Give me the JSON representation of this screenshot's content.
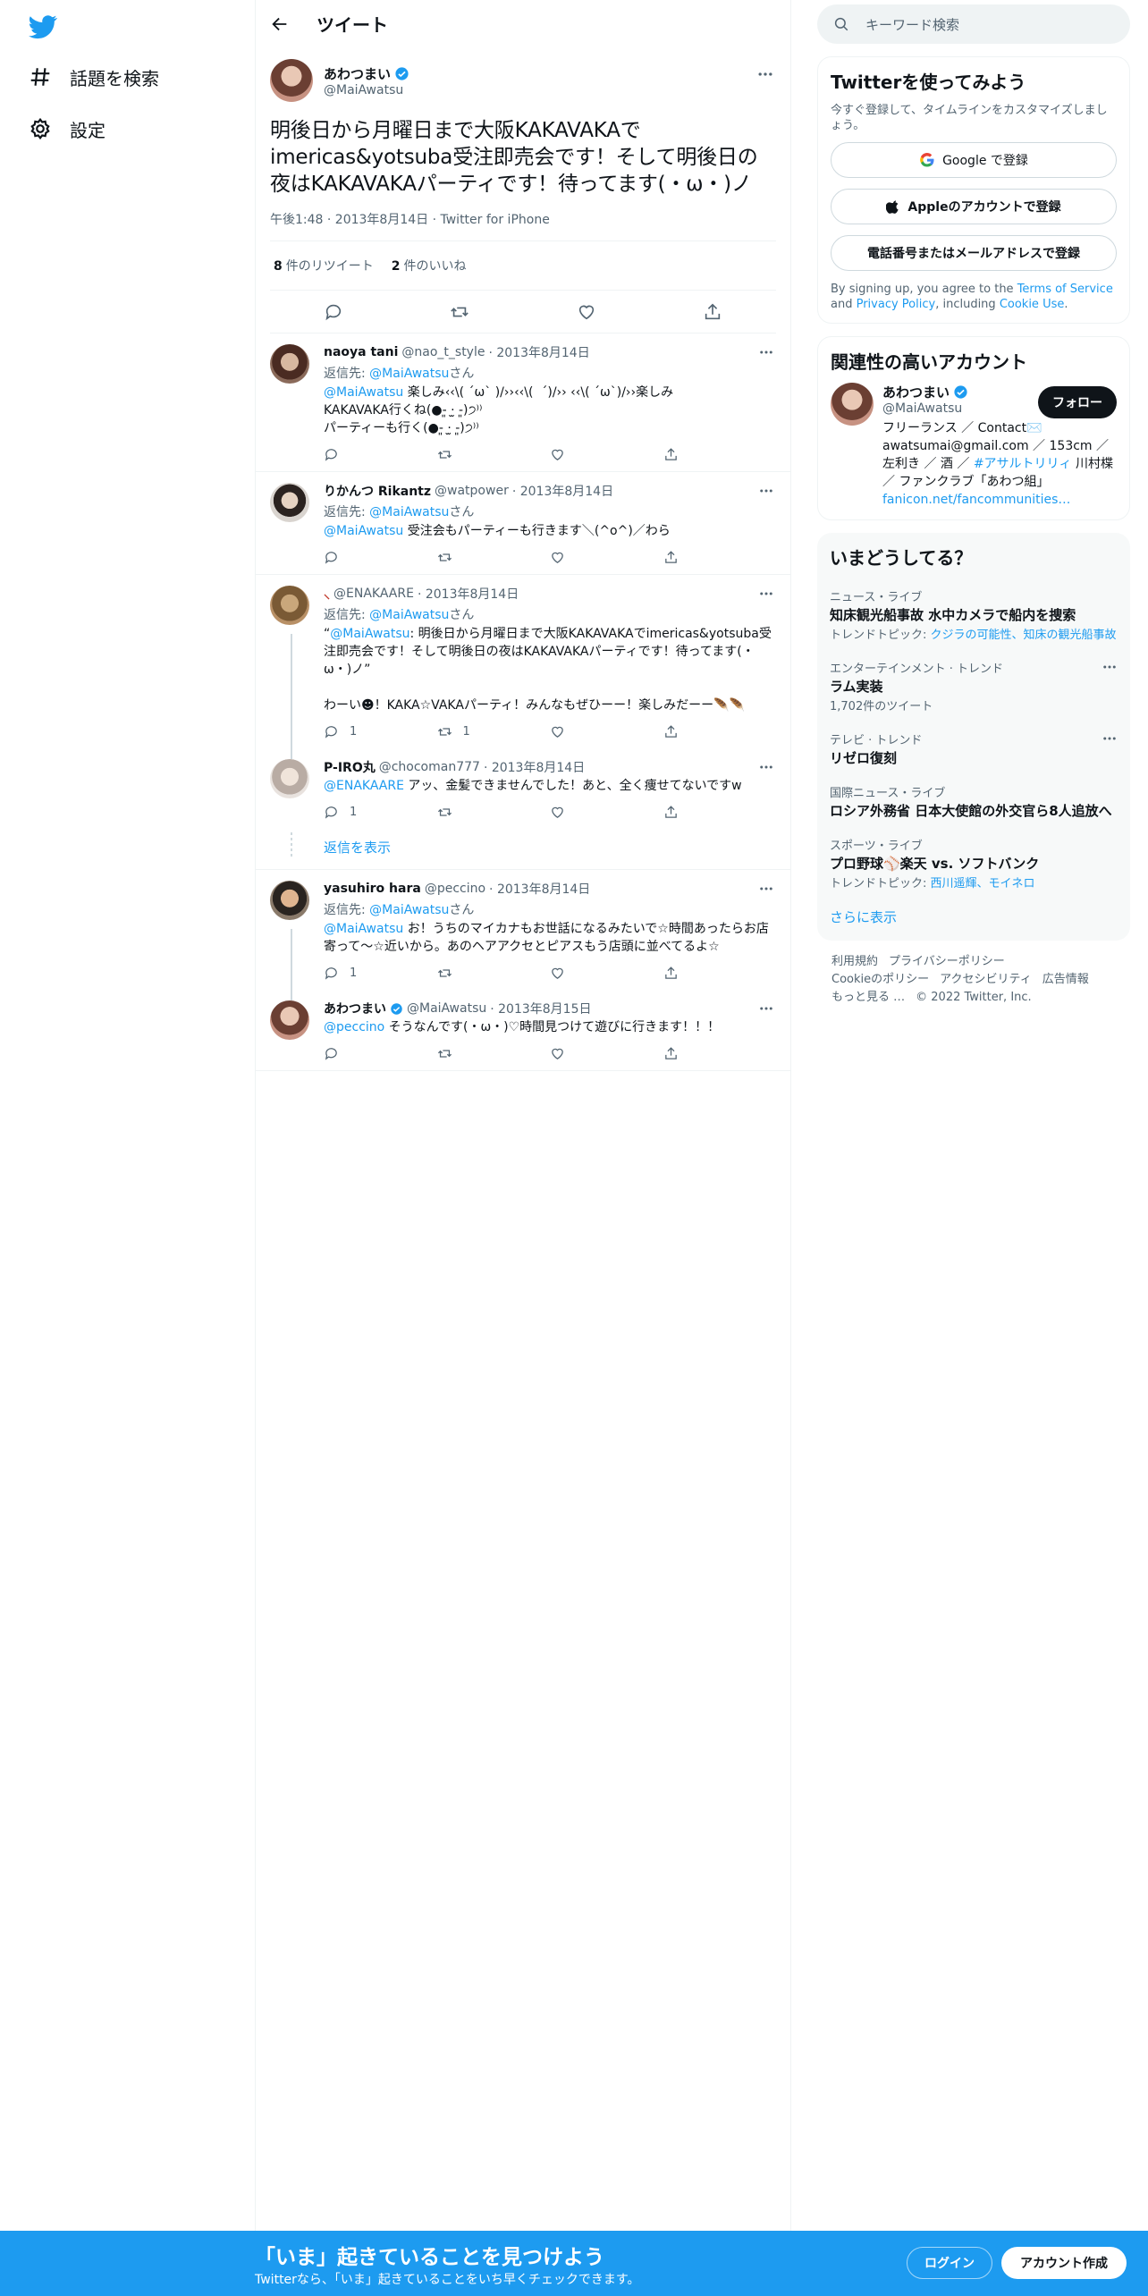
{
  "nav": {
    "explore": "話題を検索",
    "settings": "設定"
  },
  "header": {
    "title": "ツイート"
  },
  "main_tweet": {
    "name": "あわつまい",
    "handle": "@MaiAwatsu",
    "text": "明後日から月曜日まで大阪KAKAVAKAでimericas&yotsuba受注即売会です！そして明後日の夜はKAKAVAKAパーティです！待ってます(・ω・)ノ",
    "meta": "午後1:48 · 2013年8月14日 · Twitter for iPhone",
    "retweets": "8",
    "retweets_label": "件のリツイート",
    "likes": "2",
    "likes_label": "件のいいね"
  },
  "reply_prefix": "返信先: ",
  "reply_suffix": "さん",
  "replies": [
    {
      "name": "naoya tani",
      "handle": "@nao_t_style",
      "date": "· 2013年8月14日",
      "reply_to": "@MaiAwatsu",
      "mention": "@MaiAwatsu",
      "text": " 楽しみ‹‹\\( ´ω` )/››‹‹\\(  ´)/›› ‹‹\\( ´ω`)/››楽しみ\nKAKAVAKA行くね(●-͈ ·̫ -͈)੭⁾⁾\nパーティーも行く(●-͈ ·̫ -͈)੭⁾⁾",
      "reply_count": "",
      "rt_count": ""
    },
    {
      "name": "りかんつ Rikantz",
      "handle": "@watpower",
      "date": "· 2013年8月14日",
      "reply_to": "@MaiAwatsu",
      "mention": "@MaiAwatsu",
      "text": " 受注会もパーティーも行きます＼(^o^)／わら",
      "reply_count": "",
      "rt_count": ""
    },
    {
      "name": "⸜",
      "handle": "@ENAKAARE",
      "date": "· 2013年8月14日",
      "reply_to": "@MaiAwatsu",
      "quote_open": "“",
      "mention": "@MaiAwatsu",
      "text": ": 明後日から月曜日まで大阪KAKAVAKAでimericas&yotsuba受注即売会です！そして明後日の夜はKAKAVAKAパーティです！待ってます(・ω・)ノ”\n\nわーい☻！KAKA☆VAKAパーティ！みんなもぜひーー！楽しみだーー🪶🪶",
      "reply_count": "1",
      "rt_count": "1"
    },
    {
      "name": "P-IRO丸",
      "handle": "@chocoman777",
      "date": "· 2013年8月14日",
      "mention": "@ENAKAARE",
      "text": " アッ、金髪できませんでした！あと、全く痩せてないですw",
      "reply_count": "1",
      "rt_count": ""
    },
    {
      "name": "yasuhiro hara",
      "handle": "@peccino",
      "date": "· 2013年8月14日",
      "reply_to": "@MaiAwatsu",
      "mention": "@MaiAwatsu",
      "text": " お！うちのマイカナもお世話になるみたいで☆時間あったらお店寄って〜☆近いから。あのヘアアクセとピアスもう店頭に並べてるよ☆",
      "reply_count": "1",
      "rt_count": ""
    },
    {
      "name": "あわつまい",
      "handle": "@MaiAwatsu",
      "date": "· 2013年8月15日",
      "mention": "@peccino",
      "text": " そうなんです(・ω・)♡時間見つけて遊びに行きます！！！",
      "reply_count": "",
      "rt_count": ""
    }
  ],
  "show_replies": "返信を表示",
  "right": {
    "search_placeholder": "キーワード検索",
    "signup_title": "Twitterを使ってみよう",
    "signup_sub": "今すぐ登録して、タイムラインをカスタマイズしましょう。",
    "google_btn": "Google で登録",
    "apple_btn": "Appleのアカウントで登録",
    "phone_btn": "電話番号またはメールアドレスで登録",
    "terms_1": "By signing up, you agree to the ",
    "terms_link1": "Terms of Service",
    "terms_2": " and ",
    "terms_link2": "Privacy Policy",
    "terms_3": ", including ",
    "terms_link3": "Cookie Use",
    "terms_4": ".",
    "related_title": "関連性の高いアカウント",
    "related_name": "あわつまい",
    "related_handle": "@MaiAwatsu",
    "follow_btn": "フォロー",
    "bio_1": "フリーランス ／ Contact✉️ awatsumai@gmail.com ／ 153cm ／ 左利き ／ 酒 ／ ",
    "bio_hashtag": "#アサルトリリィ",
    "bio_2": " 川村楪 ／ ファンクラブ「あわつ組」",
    "bio_link": "fanicon.net/fancommunities…",
    "trends_title": "いまどうしてる？",
    "trends": [
      {
        "cat": "ニュース・ライブ",
        "title": "知床観光船事故 水中カメラで船内を捜索",
        "extra_label": "トレンドトピック: ",
        "extra_link": "クジラの可能性、知床の観光船事故",
        "more": false
      },
      {
        "cat": "エンターテインメント · トレンド",
        "title": "ラム実装",
        "extra_label": "1,702件のツイート",
        "extra_link": "",
        "more": true
      },
      {
        "cat": "テレビ · トレンド",
        "title": "リゼロ復刻",
        "extra_label": "",
        "extra_link": "",
        "more": true
      },
      {
        "cat": "国際ニュース・ライブ",
        "title": "ロシア外務省 日本大使館の外交官ら8人追放へ",
        "extra_label": "",
        "extra_link": "",
        "more": false
      },
      {
        "cat": "スポーツ・ライブ",
        "title": "プロ野球⚾楽天 vs. ソフトバンク",
        "extra_label": "トレンドトピック: ",
        "extra_link": "西川遥輝、モイネロ",
        "more": false
      }
    ],
    "show_more": "さらに表示",
    "footer": [
      "利用規約",
      "プライバシーポリシー",
      "Cookieのポリシー",
      "アクセシビリティ",
      "広告情報",
      "もっと見る …",
      "© 2022 Twitter, Inc."
    ]
  },
  "bottom_bar": {
    "title": "「いま」起きていることを見つけよう",
    "sub": "Twitterなら、「いま」起きていることをいち早くチェックできます。",
    "login": "ログイン",
    "signup": "アカウント作成"
  },
  "colors": {
    "accent": "#1d9bf0",
    "text": "#0f1419",
    "muted": "#536471"
  }
}
